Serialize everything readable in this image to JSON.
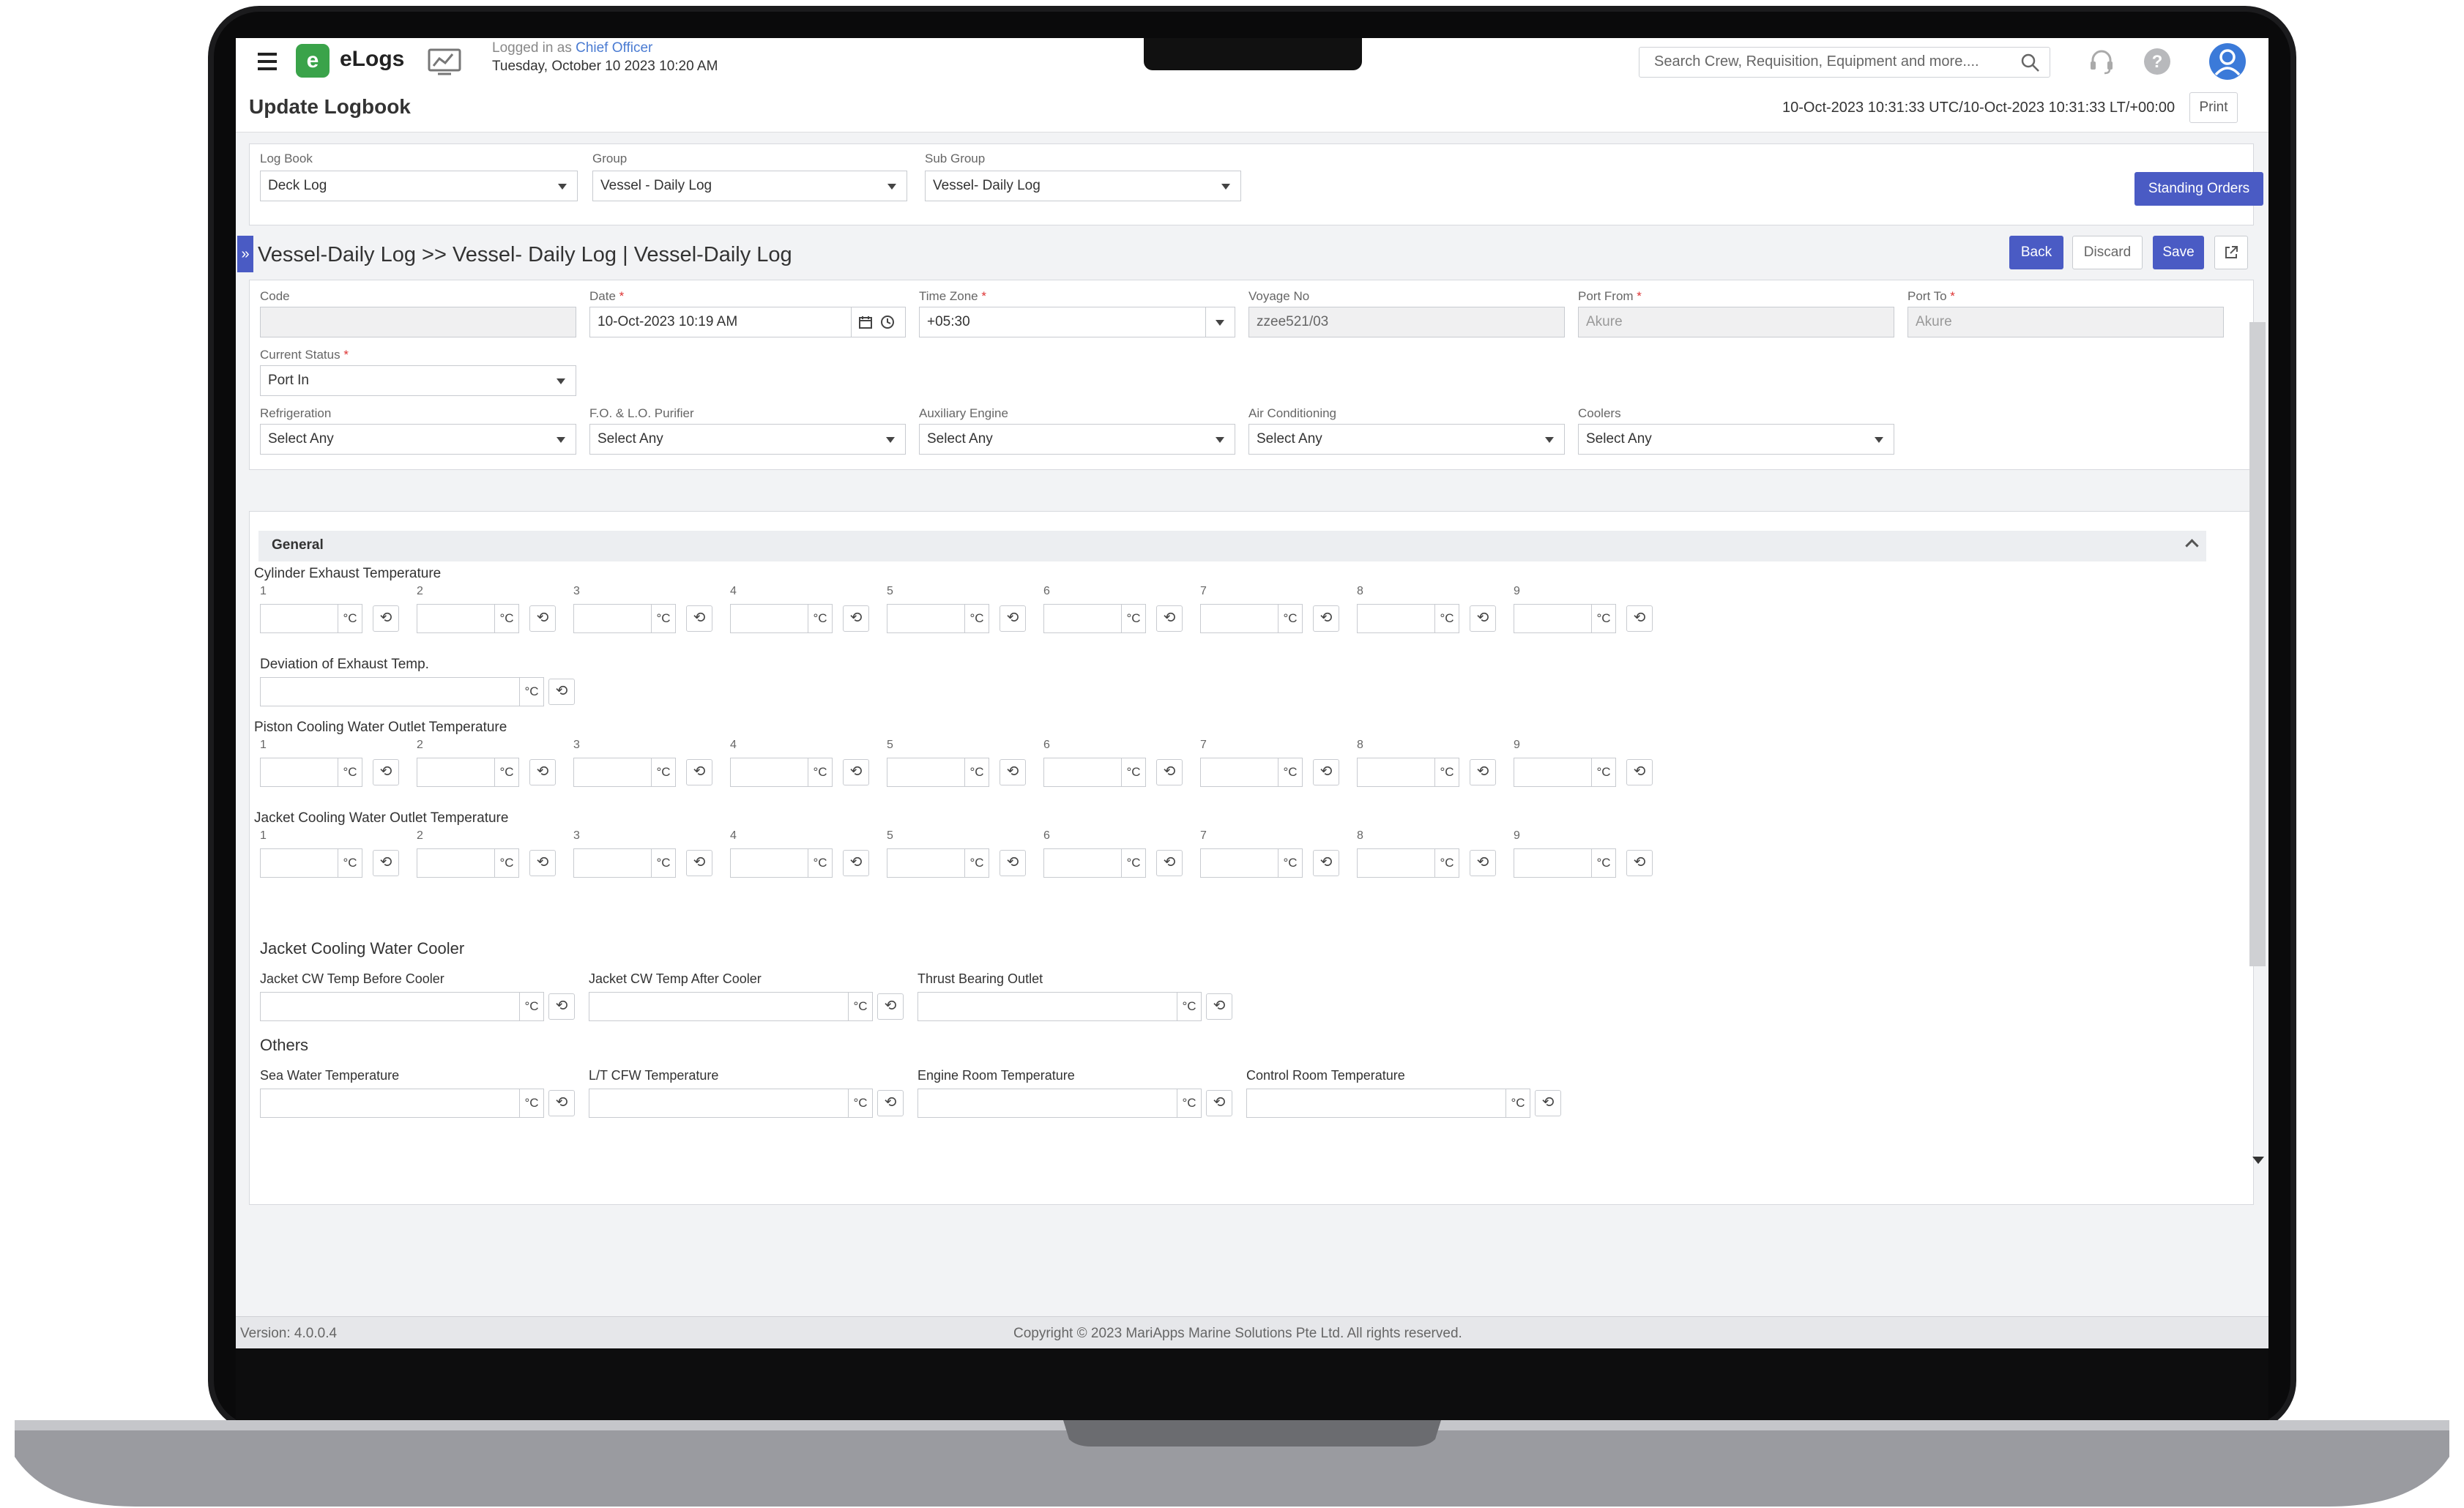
{
  "header": {
    "app_name": "eLogs",
    "logo_letter": "e",
    "login_prefix": "Logged in as ",
    "login_role": "Chief Officer",
    "login_date": "Tuesday, October 10 2023 10:20 AM",
    "search_placeholder": "Search Crew, Requisition, Equipment and more...."
  },
  "titlebar": {
    "title": "Update Logbook",
    "timestamp": "10-Oct-2023 10:31:33 UTC/10-Oct-2023 10:31:33 LT/+00:00",
    "print_label": "Print"
  },
  "selectors": {
    "logbook_label": "Log Book",
    "logbook_value": "Deck Log",
    "group_label": "Group",
    "group_value": "Vessel - Daily Log",
    "subgroup_label": "Sub Group",
    "subgroup_value": "Vessel- Daily Log",
    "standing_orders_label": "Standing Orders"
  },
  "breadcrumb": {
    "text": "Vessel-Daily Log >> Vessel- Daily Log |  Vessel-Daily Log",
    "back_label": "Back",
    "discard_label": "Discard",
    "save_label": "Save"
  },
  "form": {
    "code_label": "Code",
    "code_value": "",
    "date_label": "Date",
    "date_value": "10-Oct-2023 10:19 AM",
    "timezone_label": "Time Zone",
    "timezone_value": "+05:30",
    "voyage_label": "Voyage No",
    "voyage_value": "zzee521/03",
    "port_from_label": "Port From",
    "port_from_value": "Akure",
    "port_to_label": "Port To",
    "port_to_value": "Akure",
    "current_status_label": "Current Status",
    "current_status_value": "Port In",
    "required_mark": "*",
    "equipment": [
      {
        "label": "Refrigeration",
        "value": "Select Any"
      },
      {
        "label": "F.O. & L.O. Purifier",
        "value": "Select Any"
      },
      {
        "label": "Auxiliary Engine",
        "value": "Select Any"
      },
      {
        "label": "Air Conditioning",
        "value": "Select Any"
      },
      {
        "label": "Coolers",
        "value": "Select Any"
      }
    ]
  },
  "general": {
    "title": "General",
    "unit": "°C",
    "cylinder_exhaust_title": "Cylinder Exhaust Temperature",
    "deviation_label": "Deviation of Exhaust Temp.",
    "piston_cooling_title": "Piston Cooling Water Outlet Temperature",
    "jacket_cooling_title": "Jacket Cooling Water Outlet Temperature",
    "cylinder_numbers": [
      "1",
      "2",
      "3",
      "4",
      "5",
      "6",
      "7",
      "8",
      "9"
    ],
    "jacket_cooler_title": "Jacket Cooling Water Cooler",
    "jacket_cooler_fields": [
      "Jacket CW Temp Before Cooler",
      "Jacket CW Temp After Cooler",
      "Thrust Bearing Outlet"
    ],
    "others_title": "Others",
    "others_fields": [
      "Sea Water Temperature",
      "L/T CFW Temperature",
      "Engine Room Temperature",
      "Control Room Temperature"
    ]
  },
  "footer": {
    "version": "Version: 4.0.0.4",
    "copyright": "Copyright © 2023 MariApps Marine Solutions Pte Ltd. All rights reserved."
  },
  "colors": {
    "accent": "#4a5bc4",
    "logo_green": "#3aa34a",
    "link_blue": "#4a7bd2"
  }
}
